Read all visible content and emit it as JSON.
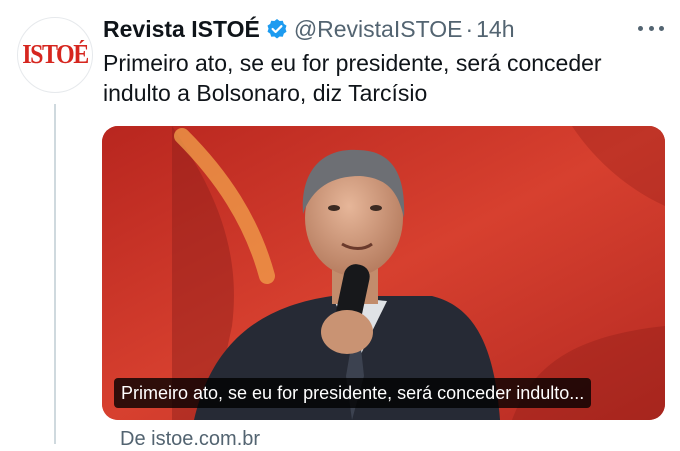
{
  "tweet": {
    "display_name": "Revista ISTOÉ",
    "handle": "@RevistaISTOE",
    "separator": "·",
    "time": "14h",
    "text": "Primeiro ato, se eu for presidente, será conceder indulto a Bolsonaro, diz Tarcísio",
    "avatar_logo_text": "ISTOÉ",
    "verified_icon": "verified-badge-icon",
    "more_icon": "more-options-icon"
  },
  "media": {
    "caption": "Primeiro ato, se eu for presidente, será conceder indulto...",
    "source": "De istoe.com.br"
  },
  "colors": {
    "brand_red": "#d6261f",
    "verified_blue": "#1d9bf0",
    "secondary_text": "#536471",
    "thread_line": "#cfd9de"
  }
}
